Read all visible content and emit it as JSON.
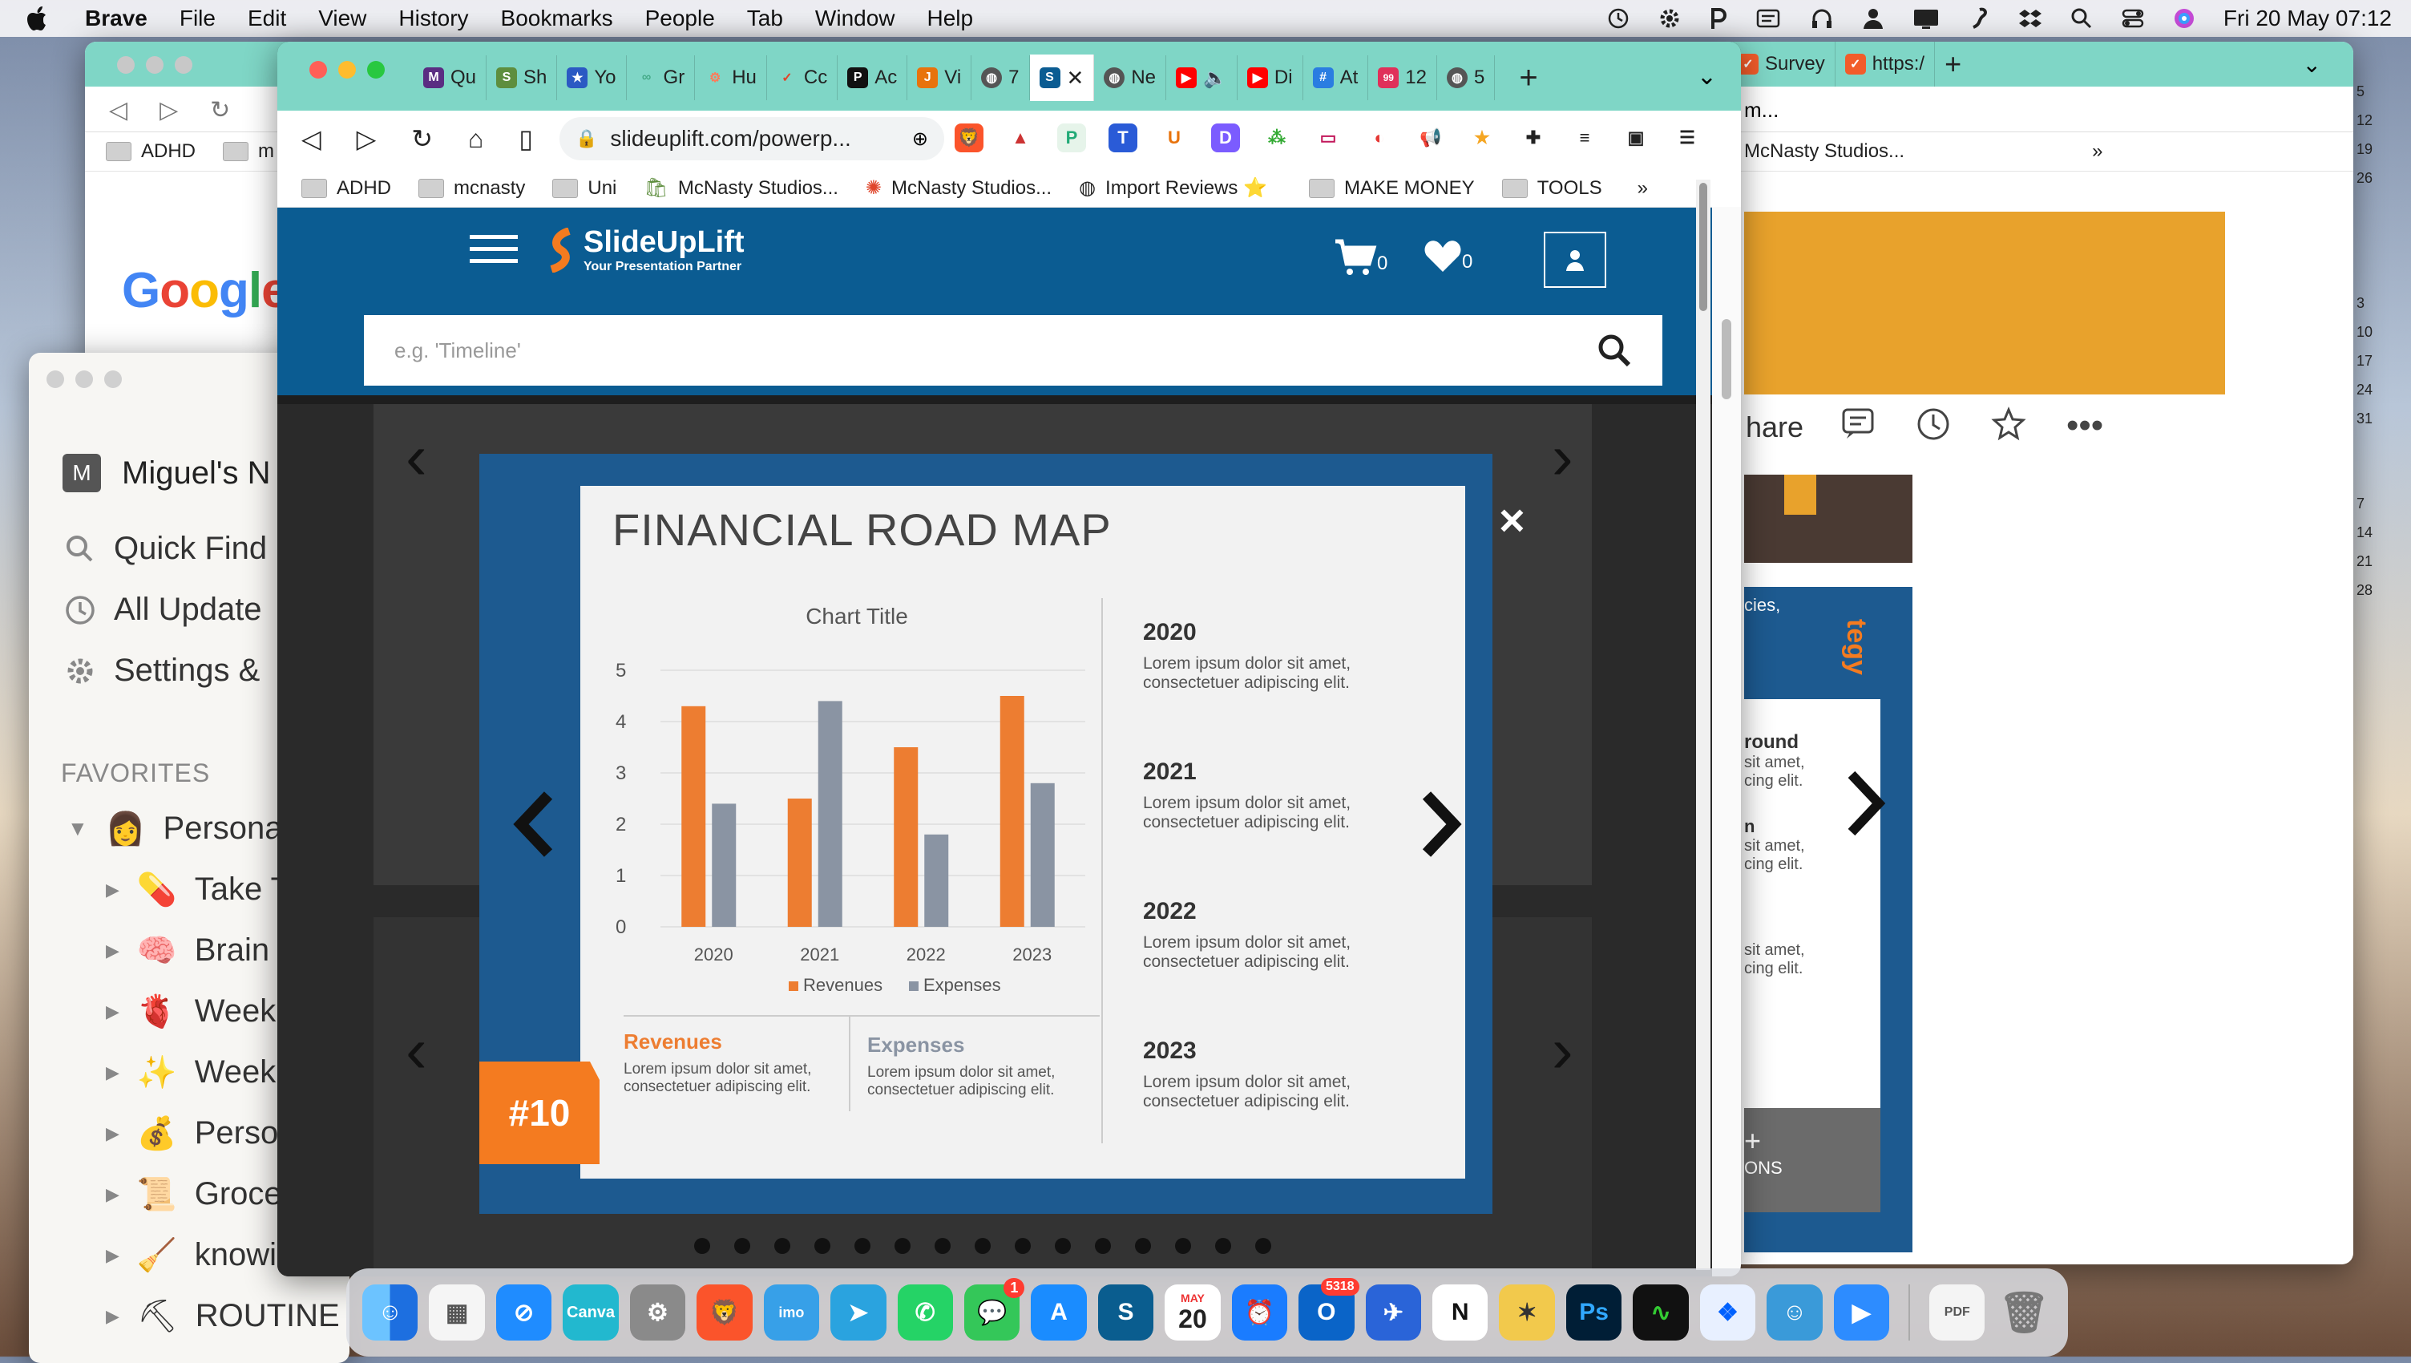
{
  "menubar": {
    "apple": "",
    "app_name": "Brave",
    "items": [
      "File",
      "Edit",
      "View",
      "History",
      "Bookmarks",
      "People",
      "Tab",
      "Window",
      "Help"
    ],
    "datetime": "Fri 20 May  07:12"
  },
  "back_window": {
    "tabs": [
      "Survey",
      "https:/"
    ],
    "bookmarks": [
      "ADHD",
      "m"
    ],
    "right_bookmark": "McNasty Studios...",
    "right_toolbar_text": "m...",
    "calendar_numbers": [
      "5",
      "12",
      "19",
      "26",
      "3",
      "10",
      "17",
      "24",
      "31",
      "7",
      "14",
      "21",
      "28"
    ]
  },
  "notion": {
    "workspace": "Miguel's N",
    "workspace_initial": "M",
    "nav": [
      "Quick Find",
      "All Update",
      "Settings &"
    ],
    "favorites_header": "FAVORITES",
    "favorites": [
      {
        "emoji": "👩",
        "label": "Persona"
      },
      {
        "emoji": "💊",
        "label": "Take T"
      },
      {
        "emoji": "🧠",
        "label": "Brain"
      },
      {
        "emoji": "🫀",
        "label": "Week"
      },
      {
        "emoji": "✨",
        "label": "Week"
      },
      {
        "emoji": "💰",
        "label": "Perso"
      },
      {
        "emoji": "📜",
        "label": "Groce"
      },
      {
        "emoji": "🧹",
        "label": "knowin"
      },
      {
        "emoji": "⛏",
        "label": "ROUTINE"
      }
    ]
  },
  "google_logo": "Google",
  "right_page": {
    "share_text": "hare",
    "partial_lines": [
      "cies,",
      "tegy",
      "round",
      "sit amet,",
      "cing elit.",
      "sit amet,",
      "cing elit.",
      "sit amet,",
      "cing elit.",
      "ONS",
      "n"
    ]
  },
  "browser": {
    "tabs": [
      "Qu",
      "Sh",
      "Yo",
      "Gr",
      "Hu",
      "Cc",
      "Ac",
      "Vi",
      "7",
      "",
      "Ne",
      "",
      "Di",
      "At",
      "12",
      "5"
    ],
    "url": "slideuplift.com/powerp...",
    "bookmarks": [
      "ADHD",
      "mcnasty",
      "Uni",
      "McNasty Studios...",
      "McNasty Studios...",
      "Import Reviews ⭐",
      "MAKE MONEY",
      "TOOLS"
    ],
    "more": "»"
  },
  "site": {
    "brand": "SlideUpLift",
    "tagline": "Your Presentation Partner",
    "cart_count": "0",
    "wishlist_count": "0",
    "search_placeholder": "e.g. 'Timeline'"
  },
  "slide": {
    "title": "FINANCIAL ROAD MAP",
    "badge": "#10",
    "close": "×",
    "years": [
      {
        "year": "2020",
        "text": "Lorem ipsum dolor sit amet, consectetuer adipiscing elit."
      },
      {
        "year": "2021",
        "text": "Lorem ipsum dolor sit amet, consectetuer adipiscing elit."
      },
      {
        "year": "2022",
        "text": "Lorem ipsum dolor sit amet, consectetuer adipiscing elit."
      },
      {
        "year": "2023",
        "text": "Lorem ipsum dolor sit amet, consectetuer adipiscing elit."
      }
    ],
    "revenues_label": "Revenues",
    "revenues_text": "Lorem ipsum dolor sit amet, consectetuer adipiscing elit.",
    "expenses_label": "Expenses",
    "expenses_text": "Lorem ipsum dolor sit amet, consectetuer adipiscing elit."
  },
  "chart_data": {
    "type": "bar",
    "title": "Chart Title",
    "categories": [
      "2020",
      "2021",
      "2022",
      "2023"
    ],
    "series": [
      {
        "name": "Revenues",
        "values": [
          4.3,
          2.5,
          3.5,
          4.5
        ],
        "color": "#ed7d31"
      },
      {
        "name": "Expenses",
        "values": [
          2.4,
          4.4,
          1.8,
          2.8
        ],
        "color": "#8a94a3"
      }
    ],
    "ylim": [
      0,
      5
    ],
    "yticks": [
      "0",
      "1",
      "2",
      "3",
      "4",
      "5"
    ],
    "legend": "bottom",
    "grid": true
  },
  "dock": {
    "notification_badge": "1",
    "mail_badge": "5318",
    "calendar_month": "MAY",
    "calendar_day": "20"
  },
  "colors": {
    "brand_blue": "#0b5c92",
    "accent_orange": "#f47b20",
    "tab_teal": "#7fd6c6"
  }
}
